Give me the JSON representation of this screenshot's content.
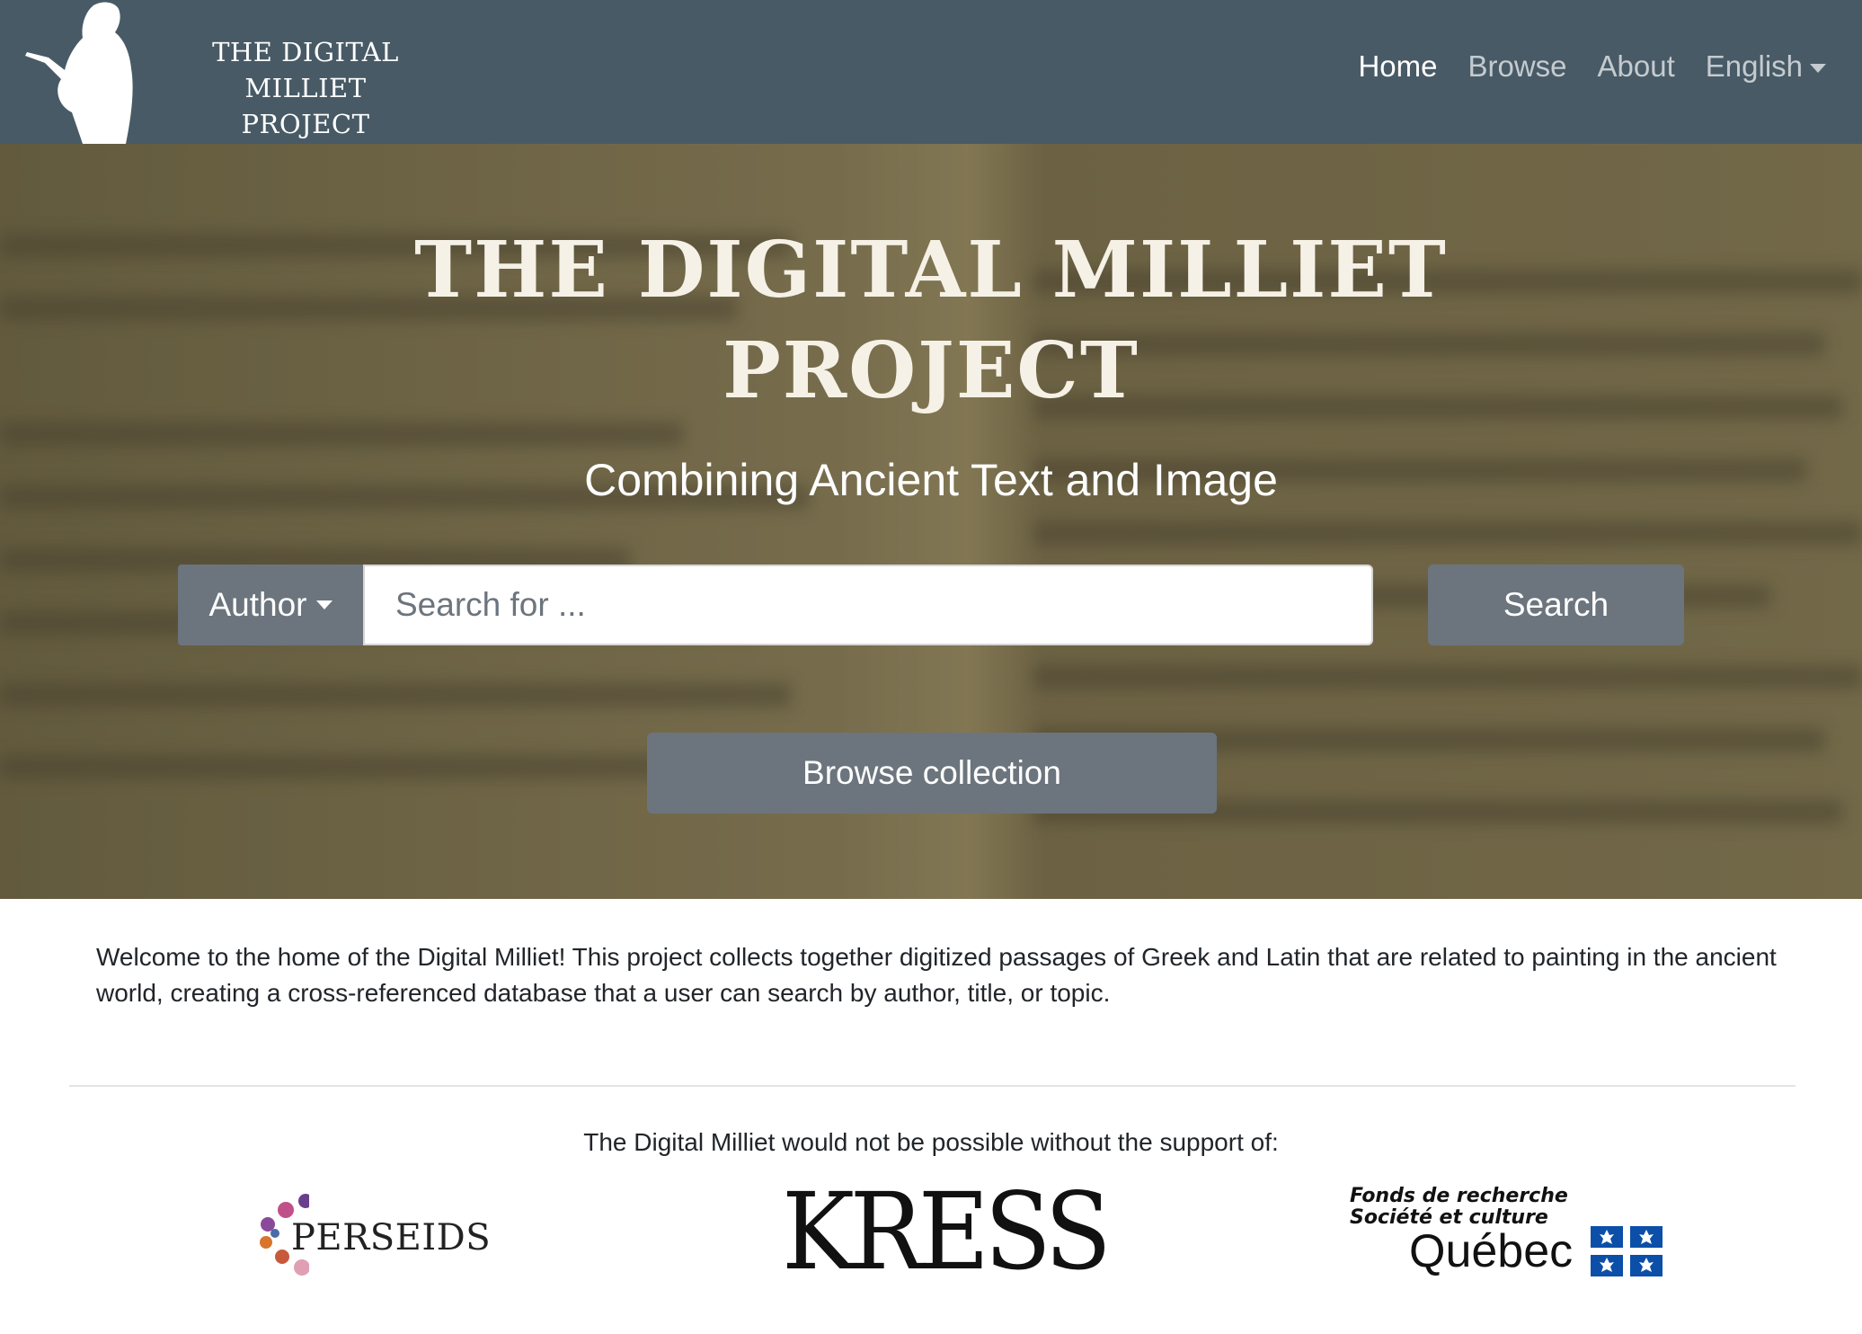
{
  "navbar": {
    "logo_line1": "THE DIGITAL MILLIET",
    "logo_line2": "PROJECT",
    "links": [
      {
        "label": "Home",
        "active": true
      },
      {
        "label": "Browse",
        "active": false
      },
      {
        "label": "About",
        "active": false
      }
    ],
    "language": "English",
    "background_color": "#485a65"
  },
  "hero": {
    "title_line1": "THE DIGITAL MILLIET",
    "title_line2": "PROJECT",
    "subtitle": "Combining Ancient Text and Image",
    "search": {
      "field_selector": "Author",
      "placeholder": "Search for ...",
      "value": "",
      "button": "Search"
    },
    "browse_button": "Browse collection",
    "button_color": "#6c757d"
  },
  "welcome_text": "Welcome to the home of the Digital Milliet! This project collects together digitized passages of Greek and Latin that are related to painting in the ancient world, creating a cross-referenced database that a user can search by author, title, or topic.",
  "support": {
    "heading": "The Digital Milliet would not be possible without the support of:",
    "sponsors": {
      "perseids": "PERSEIDS",
      "kress": "KRESS",
      "frq_line1": "Fonds de recherche",
      "frq_line2": "Société et culture",
      "frq_line3": "Québec"
    }
  }
}
